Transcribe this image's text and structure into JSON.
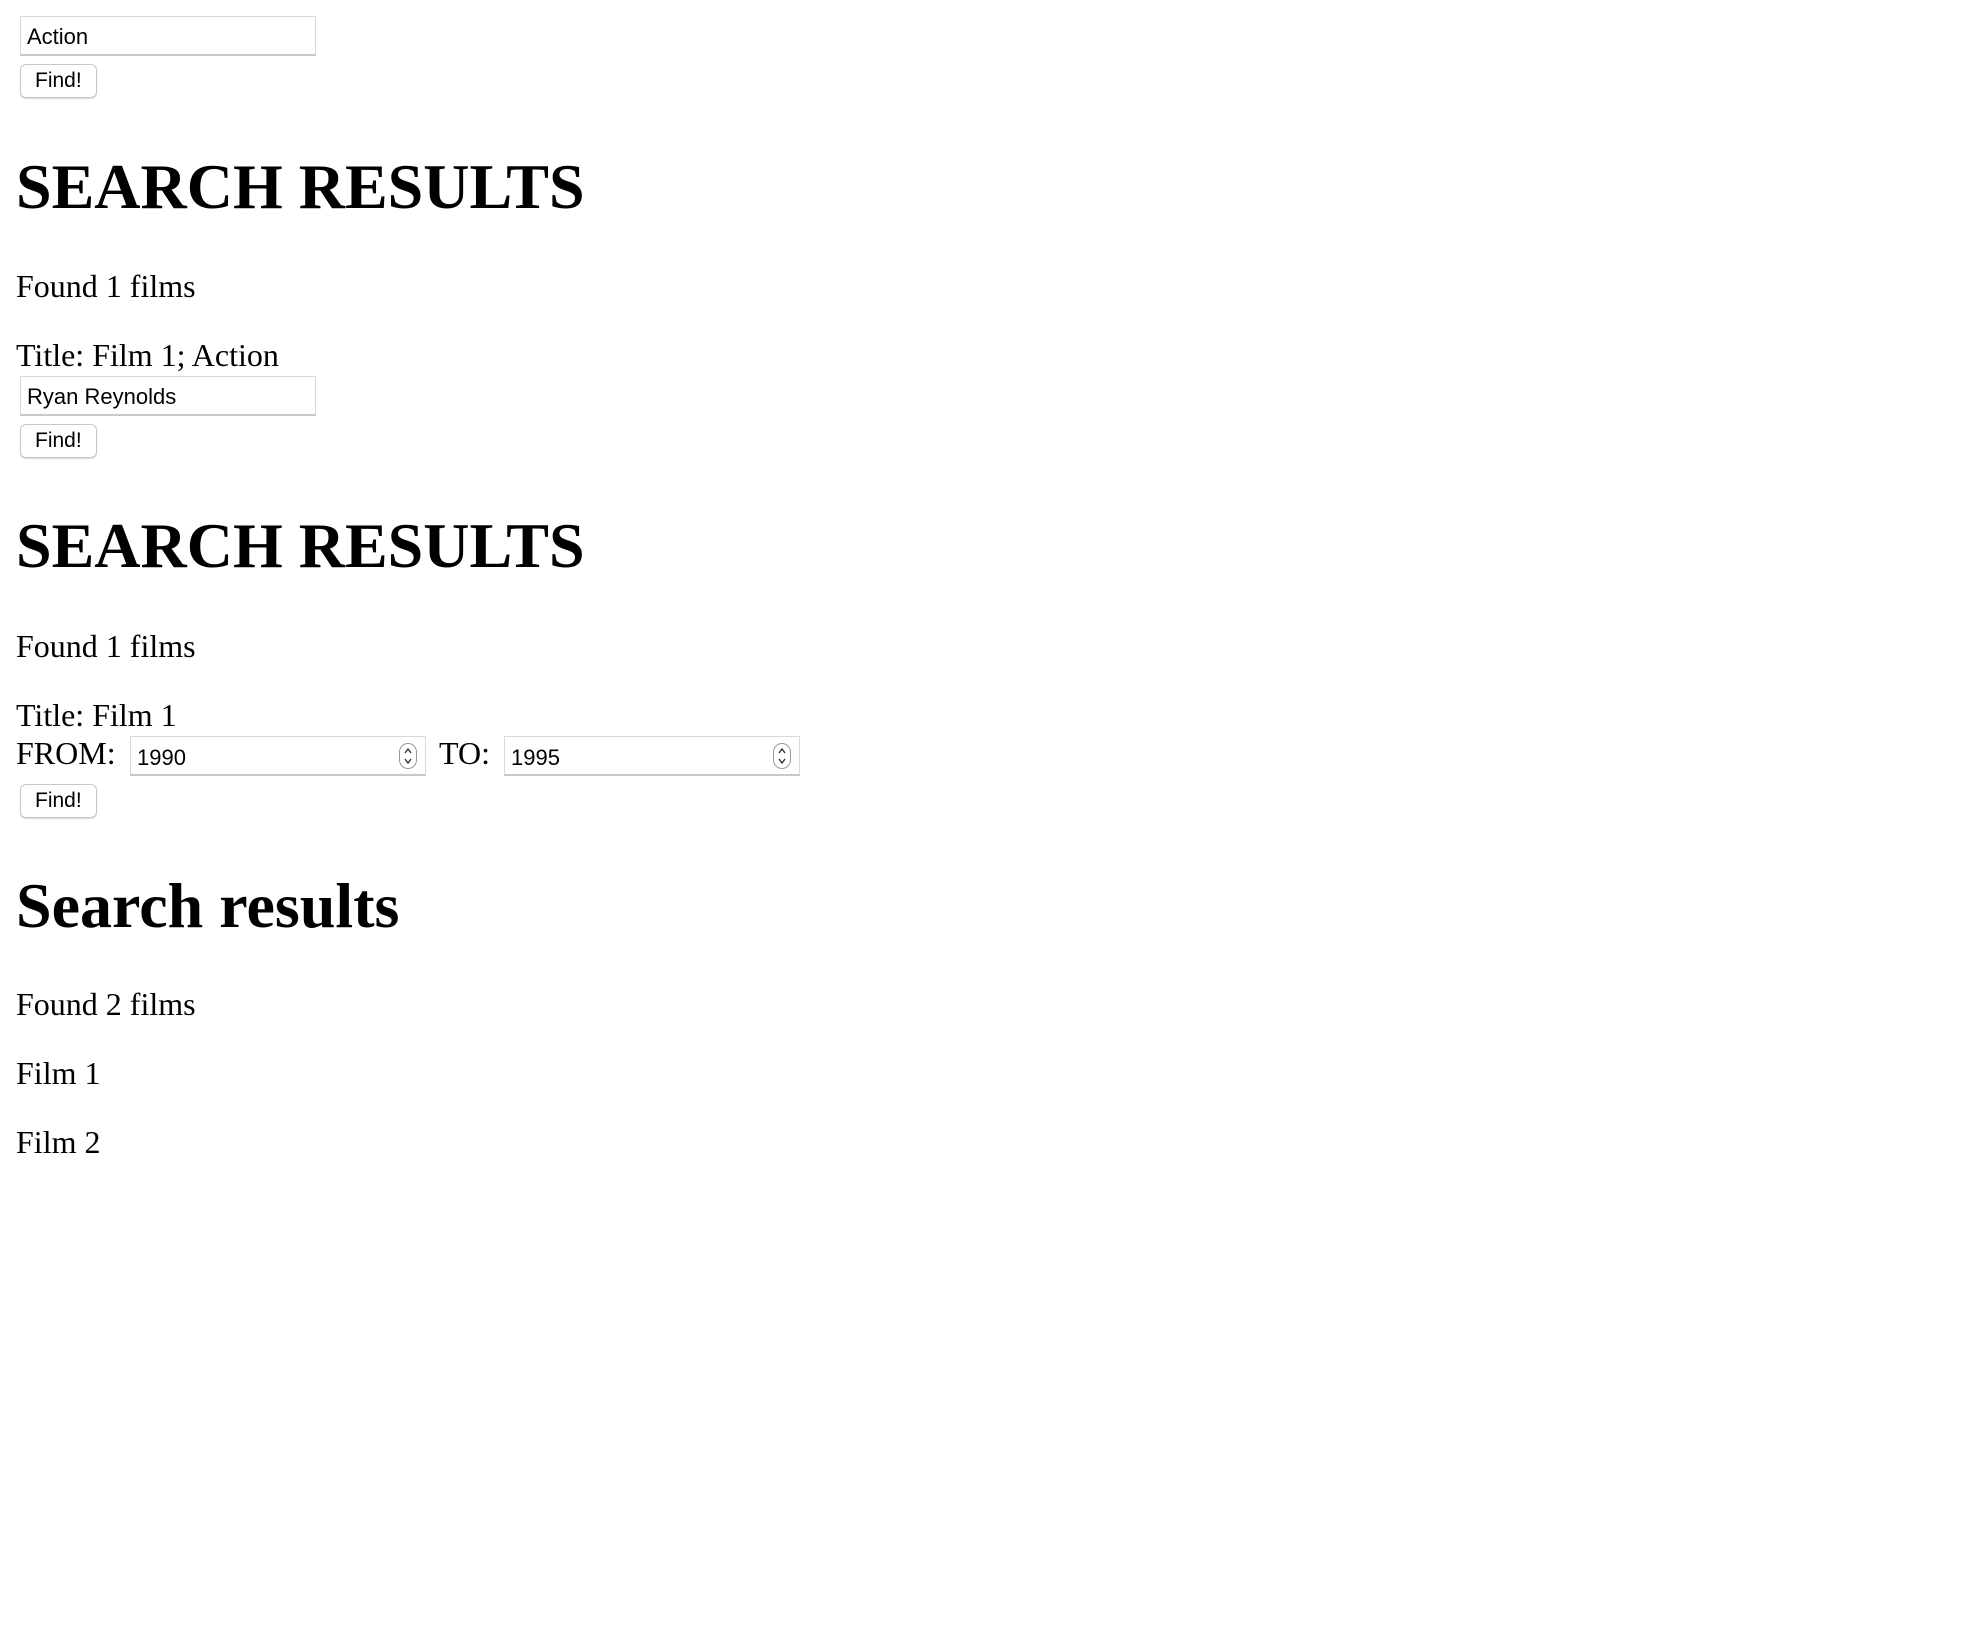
{
  "genre_search": {
    "input_value": "Action",
    "find_label": "Find!",
    "heading": "SEARCH RESULTS",
    "count_text": "Found 1 films",
    "results": [
      "Title: Film 1; Action"
    ]
  },
  "actor_search": {
    "input_value": "Ryan Reynolds",
    "find_label": "Find!",
    "heading": "SEARCH RESULTS",
    "count_text": "Found 1 films",
    "results": [
      "Title: Film 1"
    ]
  },
  "year_search": {
    "from_label": "FROM:",
    "from_value": "1990",
    "to_label": "TO:",
    "to_value": "1995",
    "find_label": "Find!",
    "heading": "Search results",
    "count_text": "Found 2 films",
    "results": [
      "Film 1",
      "Film 2"
    ]
  }
}
